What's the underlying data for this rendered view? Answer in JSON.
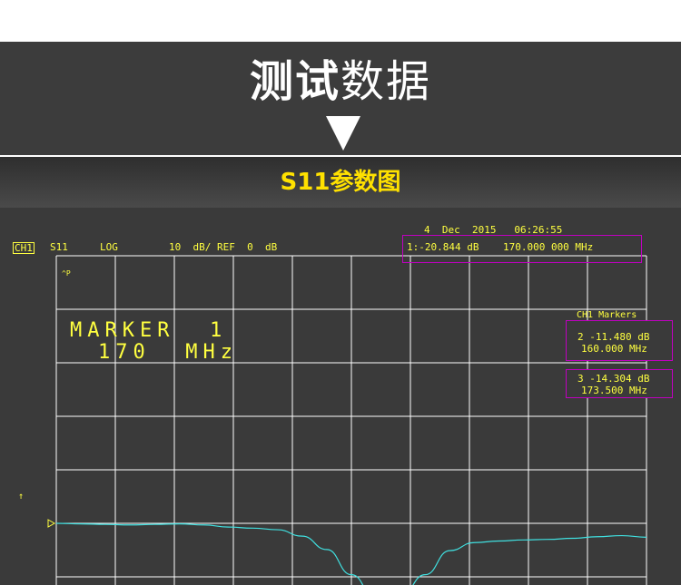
{
  "header": {
    "title_bold": "测试",
    "title_light": "数据",
    "subtitle": "S11参数图"
  },
  "vna": {
    "datetime": "4  Dec  2015   06:26:55",
    "channel": "CH1",
    "param": "S11",
    "format": "LOG",
    "scale": "10  dB/ REF  0  dB",
    "active_marker": "1:-20.844 dB    170.000 000 MHz",
    "small_marker": "^P",
    "big_marker_title": "MARKER  1",
    "big_marker_freq": "170  MHz",
    "markers_title": "CH1 Markers",
    "marker2_db": "2 -11.480 dB",
    "marker2_freq": "160.000 MHz",
    "marker3_db": "3 -14.304 dB",
    "marker3_freq": "173.500 MHz",
    "ref_symbol": "↑",
    "colors": {
      "grid": "#ffffff",
      "trace": "#40e0e0",
      "text": "#ffff40",
      "marker_box": "#c000c0"
    }
  },
  "chart_data": {
    "type": "line",
    "title": "",
    "xlabel": "",
    "ylabel": "",
    "ylim": [
      -50,
      0
    ],
    "series": [
      {
        "values": [
          -7.9,
          -8.0,
          -8.1,
          -8.2,
          -8.1,
          -8.0,
          -8.2,
          -8.6,
          -8.8,
          -9.1,
          -10.3,
          -12.8,
          -17.5,
          -22.0,
          -21.5,
          -17.5,
          -13.0,
          -11.5,
          -11.2,
          -11.0,
          -10.9,
          -10.7,
          -10.4,
          -10.2,
          -10.5
        ]
      }
    ]
  }
}
